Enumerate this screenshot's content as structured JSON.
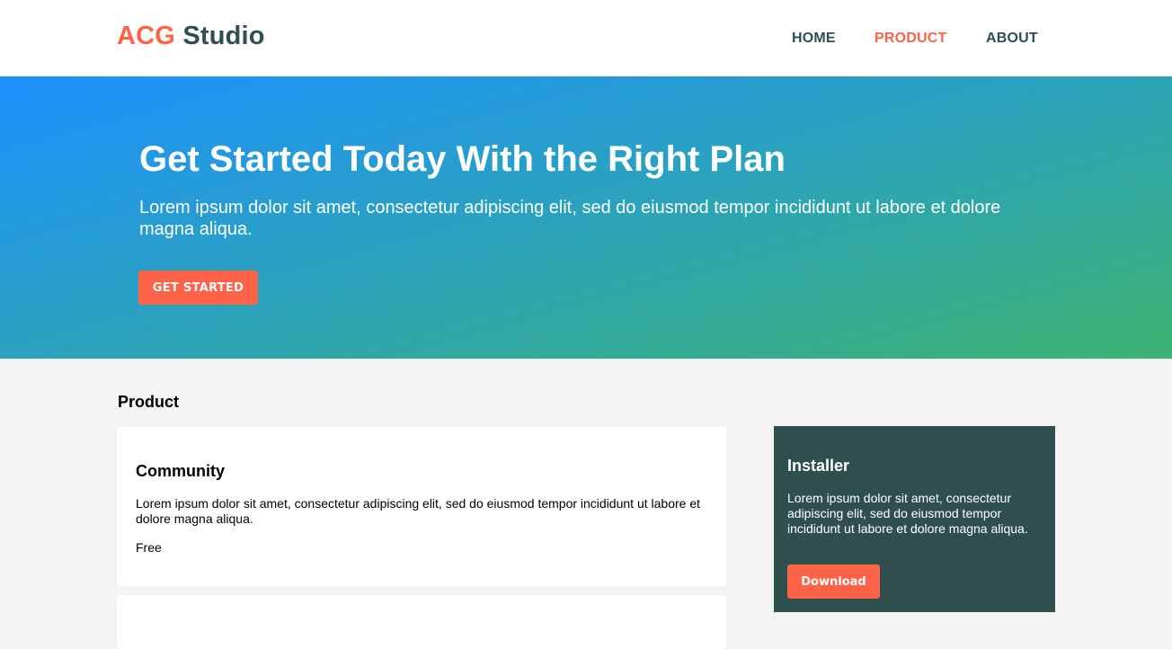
{
  "header": {
    "logo_accent": "ACG",
    "logo_rest": "Studio",
    "nav": [
      {
        "label": "HOME",
        "active": false
      },
      {
        "label": "PRODUCT",
        "active": true
      },
      {
        "label": "ABOUT",
        "active": false
      }
    ]
  },
  "hero": {
    "title": "Get Started Today With the Right Plan",
    "subtitle": "Lorem ipsum dolor sit amet, consectetur adipiscing elit, sed do eiusmod tempor incididunt ut labore et dolore magna aliqua.",
    "button_label": "GET STARTED"
  },
  "products": {
    "section_title": "Product",
    "cards": [
      {
        "title": "Community",
        "description": "Lorem ipsum dolor sit amet, consectetur adipiscing elit, sed do eiusmod tempor incididunt ut labore et dolore magna aliqua.",
        "price": "Free"
      }
    ]
  },
  "installer": {
    "title": "Installer",
    "description": "Lorem ipsum dolor sit amet, consectetur adipiscing elit, sed do eiusmod tempor incididunt ut labore et dolore magna aliqua.",
    "button_label": "Download"
  },
  "colors": {
    "accent": "#ff6347",
    "dark": "#2f4f4f",
    "hero_gradient_start": "#1e90ff",
    "hero_gradient_end": "#3cb371",
    "page_background": "#f4f4f4"
  }
}
